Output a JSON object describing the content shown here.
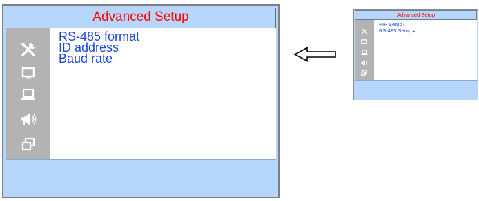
{
  "main_panel": {
    "title": "Advanced Setup",
    "menu_items": [
      "RS-485 format",
      "ID address",
      "Baud rate"
    ],
    "sidebar_icons": [
      "tools-icon",
      "monitor-icon",
      "laptop-icon",
      "speaker-icon",
      "windows-icon"
    ]
  },
  "arrow": {
    "icon": "left-arrow-icon"
  },
  "preview_panel": {
    "title": "Advanced Setup",
    "menu_items": [
      {
        "label": "PIP Setup",
        "caret": "▸"
      },
      {
        "label": "RS-485 Setup",
        "caret": "▸"
      }
    ],
    "sidebar_icons": [
      "tools-icon",
      "monitor-icon",
      "laptop-icon",
      "speaker-icon",
      "windows-icon"
    ]
  },
  "colors": {
    "title_text": "#ff0000",
    "menu_text": "#1f45d9",
    "panel_bg": "#b7d6fb",
    "sidebar_bg": "#b3b3b3",
    "content_bg": "#ffffff"
  }
}
